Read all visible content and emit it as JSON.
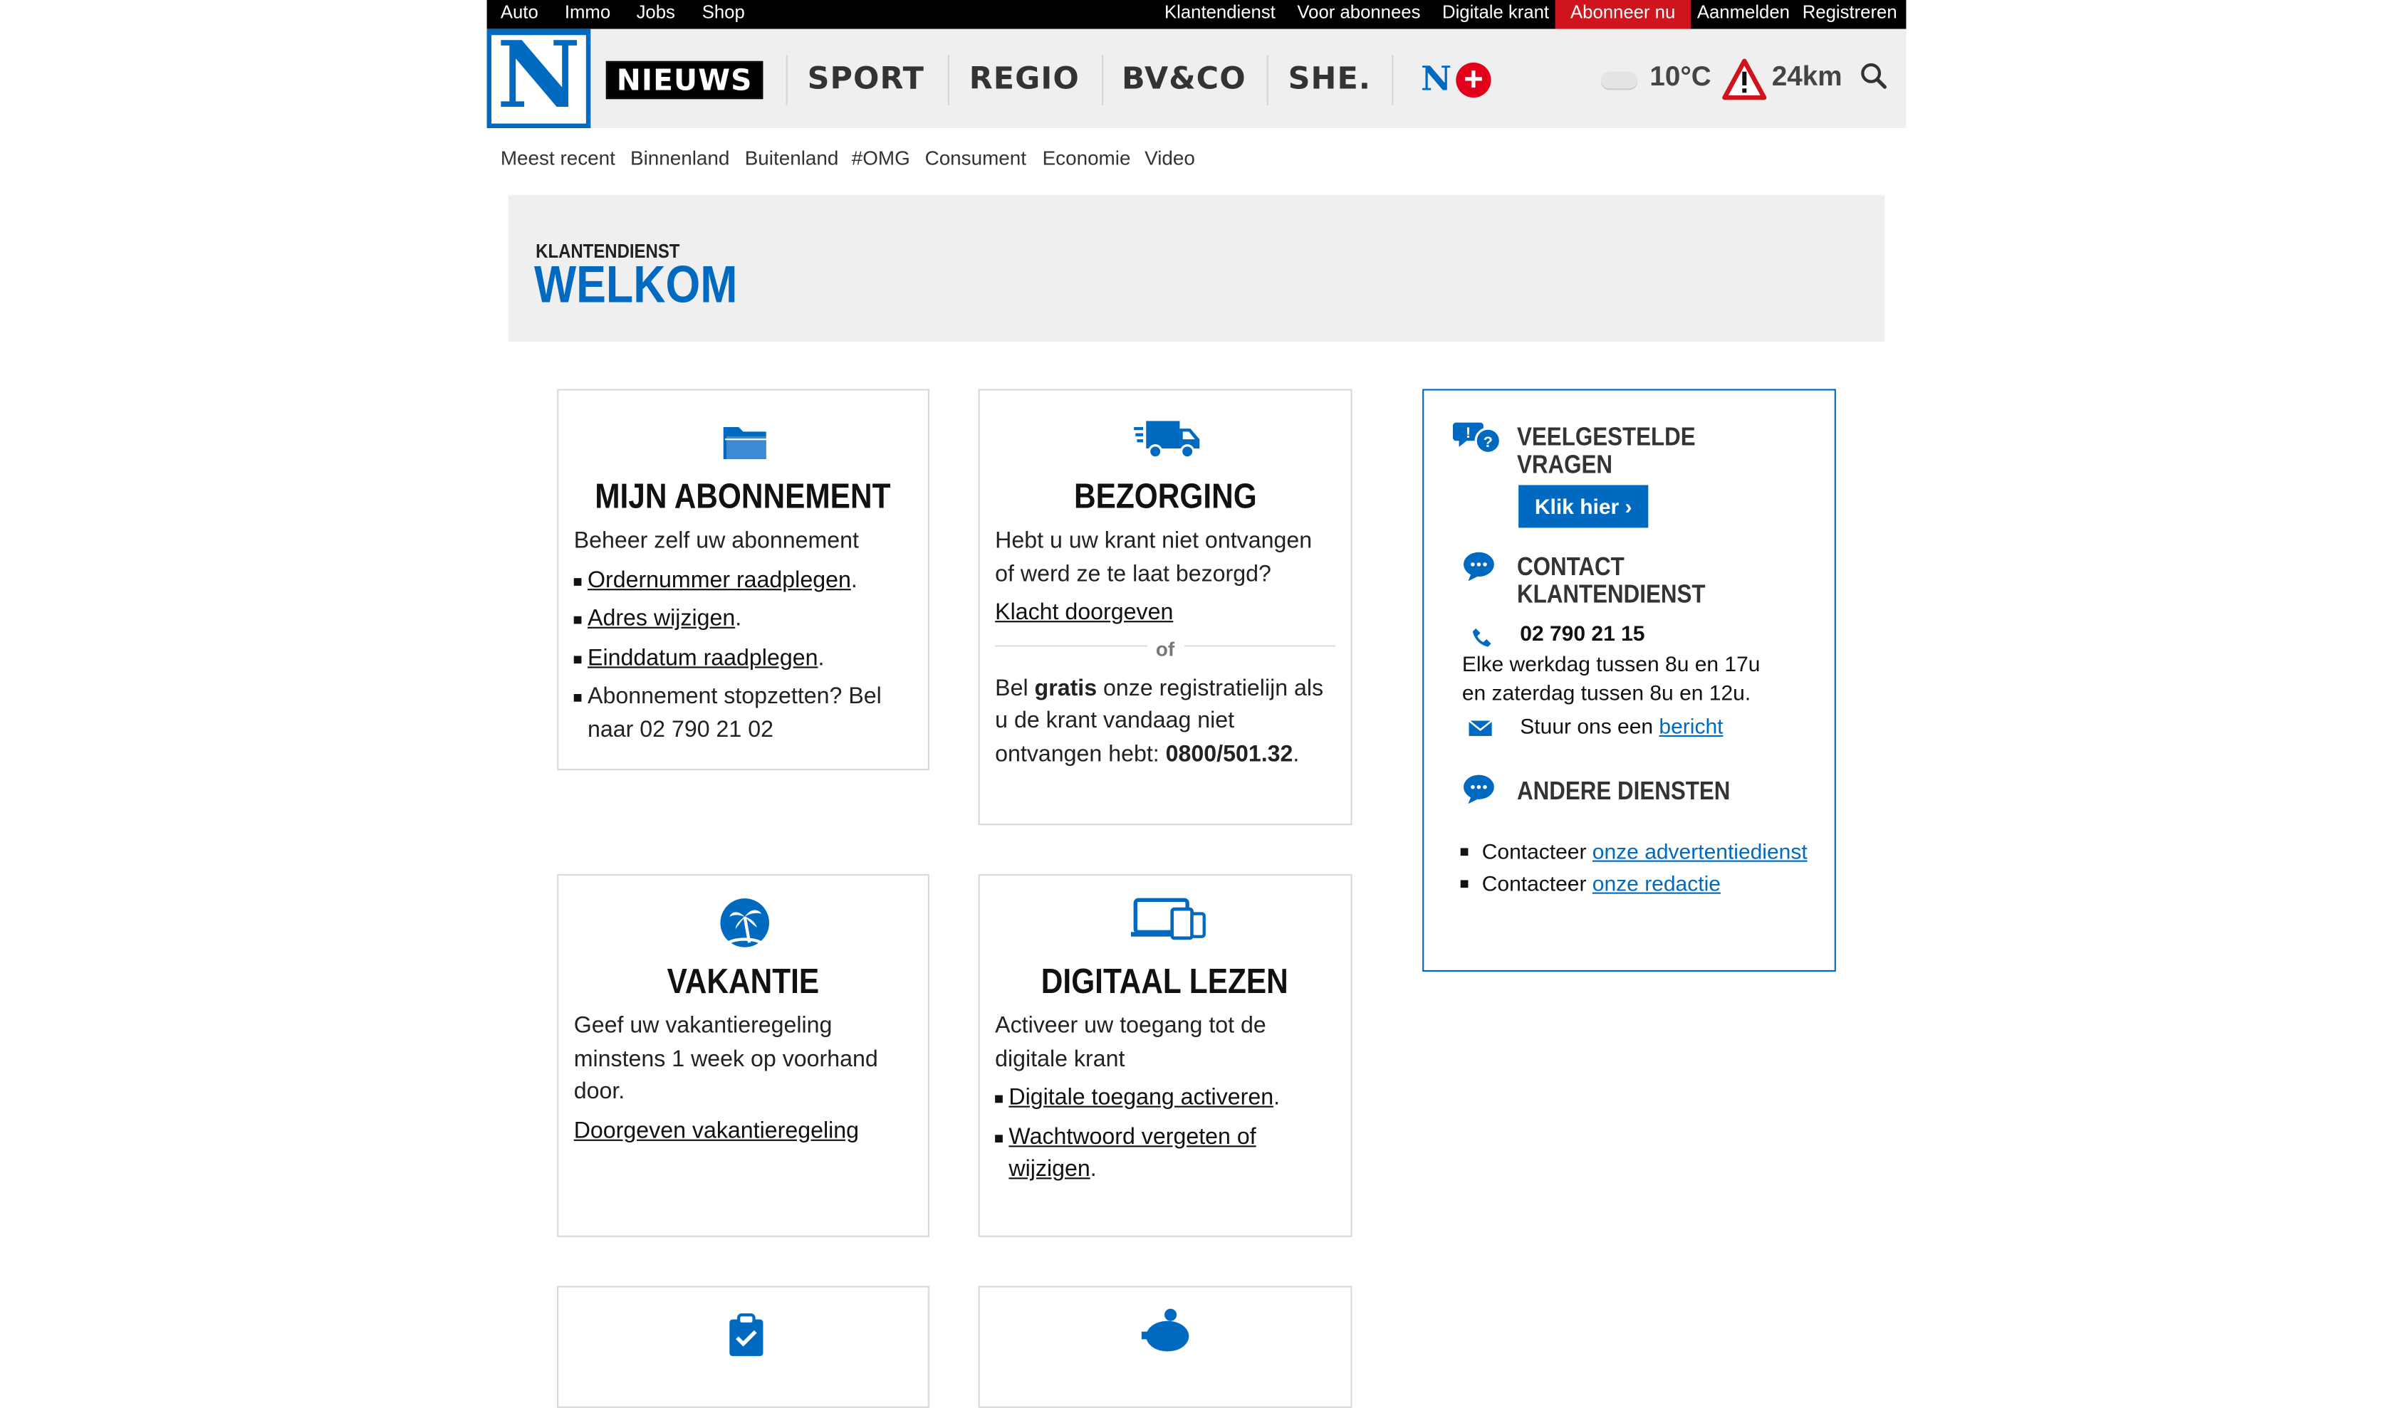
{
  "topbar": {
    "left_links": [
      "Auto",
      "Immo",
      "Jobs",
      "Shop"
    ],
    "right_links": [
      "Klantendienst",
      "Voor abonnees",
      "Digitale krant"
    ],
    "abonneer": "Abonneer nu",
    "aanmelden": "Aanmelden",
    "registreren": "Registreren"
  },
  "header": {
    "logo_letter": "N",
    "nav": [
      "NIEUWS",
      "SPORT",
      "REGIO",
      "BV&CO",
      "SHE."
    ],
    "nplus_letter": "N",
    "nplus_symbol": "+",
    "temperature": "10°C",
    "traffic": "24km",
    "icons": [
      "cloud-icon",
      "warning-triangle-icon",
      "search-icon"
    ]
  },
  "subnav": [
    "Meest recent",
    "Binnenland",
    "Buitenland",
    "#OMG",
    "Consument",
    "Economie",
    "Video"
  ],
  "welcome": {
    "kicker": "KLANTENDIENST",
    "title": "WELKOM"
  },
  "cards": {
    "abonnement": {
      "icon": "folder-icon",
      "title": "MIJN ABONNEMENT",
      "intro": "Beheer zelf uw abonnement",
      "link1": "Ordernummer raadplegen",
      "link2": "Adres wijzigen",
      "link3": "Einddatum raadplegen",
      "dot": ".",
      "stop": "Abonnement stopzetten? Bel naar 02 790 21 02"
    },
    "bezorging": {
      "icon": "truck-icon",
      "title": "BEZORGING",
      "intro": "Hebt u uw krant niet ontvangen of werd ze te laat bezorgd?",
      "link": "Klacht doorgeven",
      "or": "of",
      "bel": "Bel ",
      "gratis": "gratis",
      "rest": " onze registratielijn als u de krant vandaag niet ontvangen hebt: ",
      "number": "0800/501.32",
      "dot": "."
    },
    "vakantie": {
      "icon": "palm-tree-icon",
      "title": "VAKANTIE",
      "intro": "Geef uw vakantieregeling minstens 1 week op voorhand door.",
      "link": "Doorgeven vakantieregeling"
    },
    "digitaal": {
      "icon": "devices-icon",
      "title": "DIGITAAL LEZEN",
      "intro": "Activeer uw toegang tot de digitale krant",
      "link1": "Digitale toegang activeren",
      "link2": "Wachtwoord vergeten of wijzigen",
      "dot": "."
    },
    "row3": {
      "left_icon": "clipboard-icon",
      "right_icon": "piggy-bank-icon"
    }
  },
  "sidebar": {
    "faq_icon": "faq-bubbles-icon",
    "faq_title": "VEELGESTELDE VRAGEN",
    "faq_button": "Klik hier ›",
    "contact_icon": "chat-bubble-icon",
    "contact_title_1": "CONTACT",
    "contact_title_2": "KLANTENDIENST",
    "phone_icon": "phone-icon",
    "phone": "02 790 21 15",
    "hours_1": "Elke werkdag tussen 8u en 17u",
    "hours_2": "en zaterdag tussen 8u en 12u.",
    "mail_icon": "envelope-icon",
    "mail_text": "Stuur ons een ",
    "mail_link": "bericht",
    "other_icon": "chat-bubble-icon",
    "other_title": "ANDERE DIENSTEN",
    "contacteer": "Contacteer ",
    "link_advert": "onze advertentiedienst",
    "link_redactie": "onze redactie"
  },
  "colors": {
    "brand_blue": "#0069c0",
    "abonneer_red": "#d0141d",
    "header_bg": "#efefef"
  }
}
